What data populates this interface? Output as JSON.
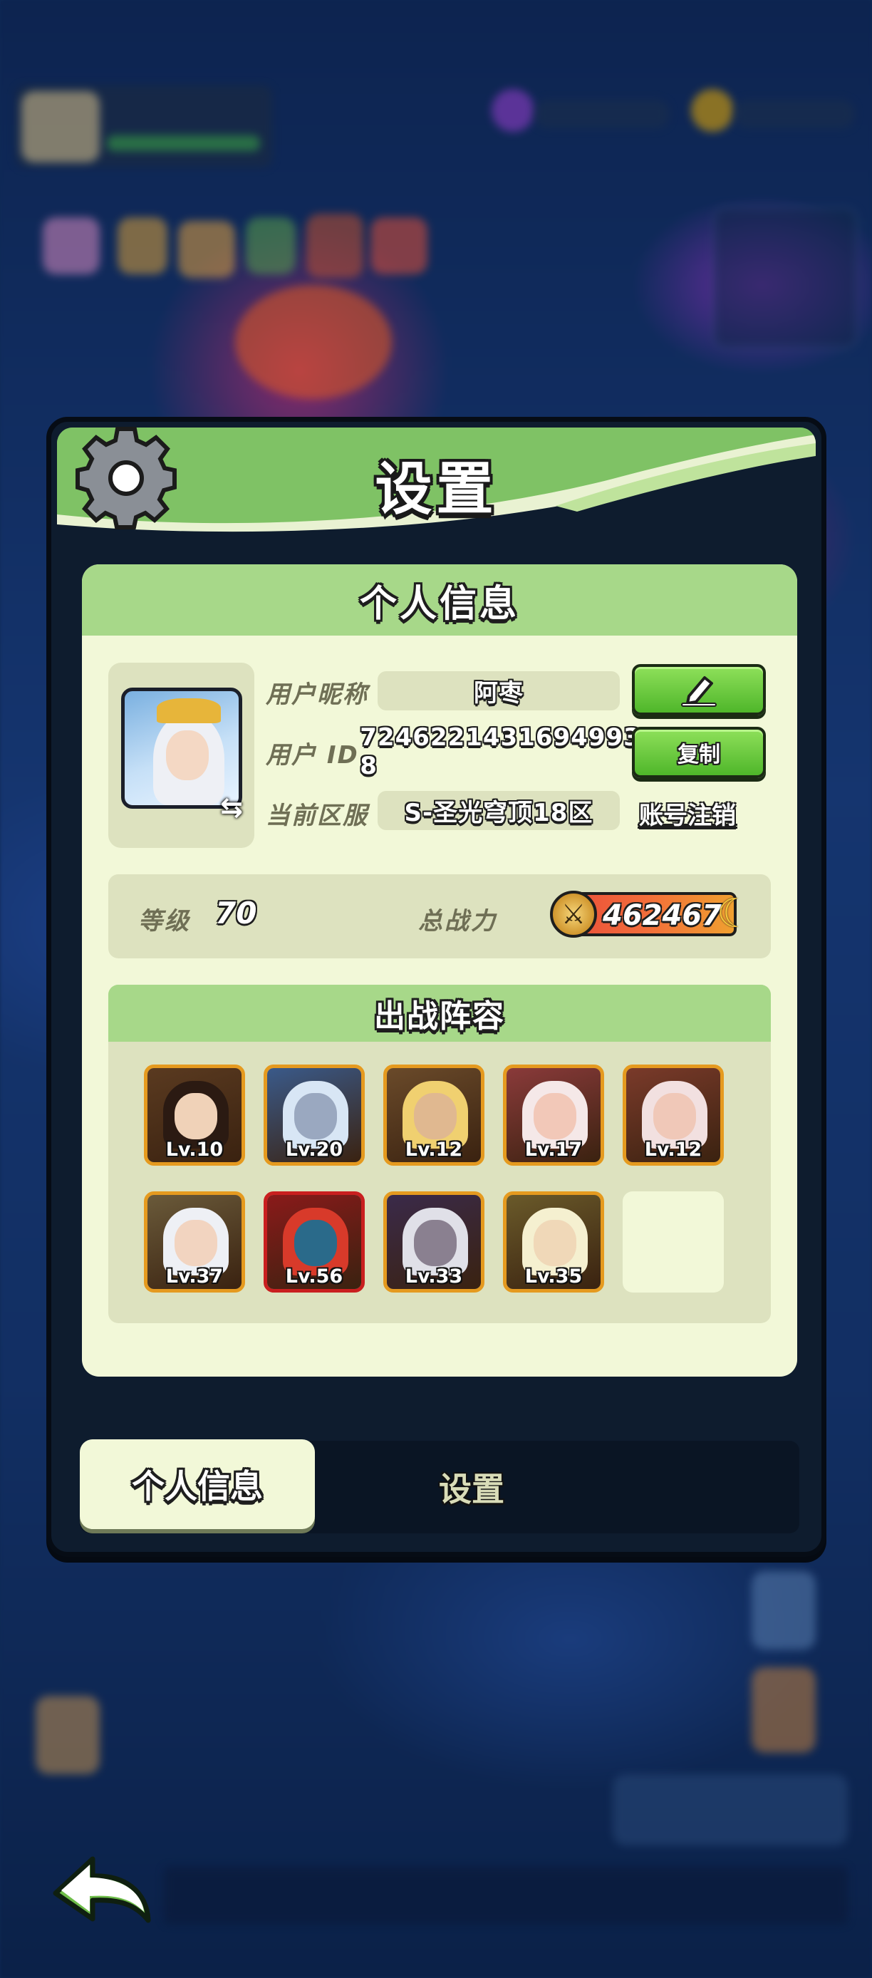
{
  "panel": {
    "title": "设置",
    "section_title": "个人信息",
    "profile": {
      "nickname_label": "用户昵称",
      "nickname_value": "阿枣",
      "id_label": "用户  ID",
      "id_value": "7246221431694993​8",
      "server_label": "当前区服",
      "server_value": "S-圣光穹顶18区",
      "copy_button": "复制",
      "account_cancel_link": "账号注销"
    },
    "stats": {
      "level_label": "等级",
      "level_value": "70",
      "power_label": "总战力",
      "power_value": "462467"
    },
    "lineup": {
      "title": "出战阵容",
      "heroes": [
        {
          "level": "Lv.10"
        },
        {
          "level": "Lv.20"
        },
        {
          "level": "Lv.12"
        },
        {
          "level": "Lv.17"
        },
        {
          "level": "Lv.12"
        },
        {
          "level": "Lv.37"
        },
        {
          "level": "Lv.56"
        },
        {
          "level": "Lv.33"
        },
        {
          "level": "Lv.35"
        }
      ]
    },
    "tabs": {
      "active": "个人信息",
      "inactive": "设置"
    }
  },
  "colors": {
    "panel_green": "#7fc265",
    "card_bg": "#f2f8d8",
    "button_green": "#4fb62a",
    "frame_gold": "#e59a1f",
    "frame_red": "#c91f1f"
  },
  "icons": [
    "gear-icon",
    "edit-pencil-icon",
    "swap-icon",
    "power-swords-icon",
    "back-arrow-icon"
  ]
}
